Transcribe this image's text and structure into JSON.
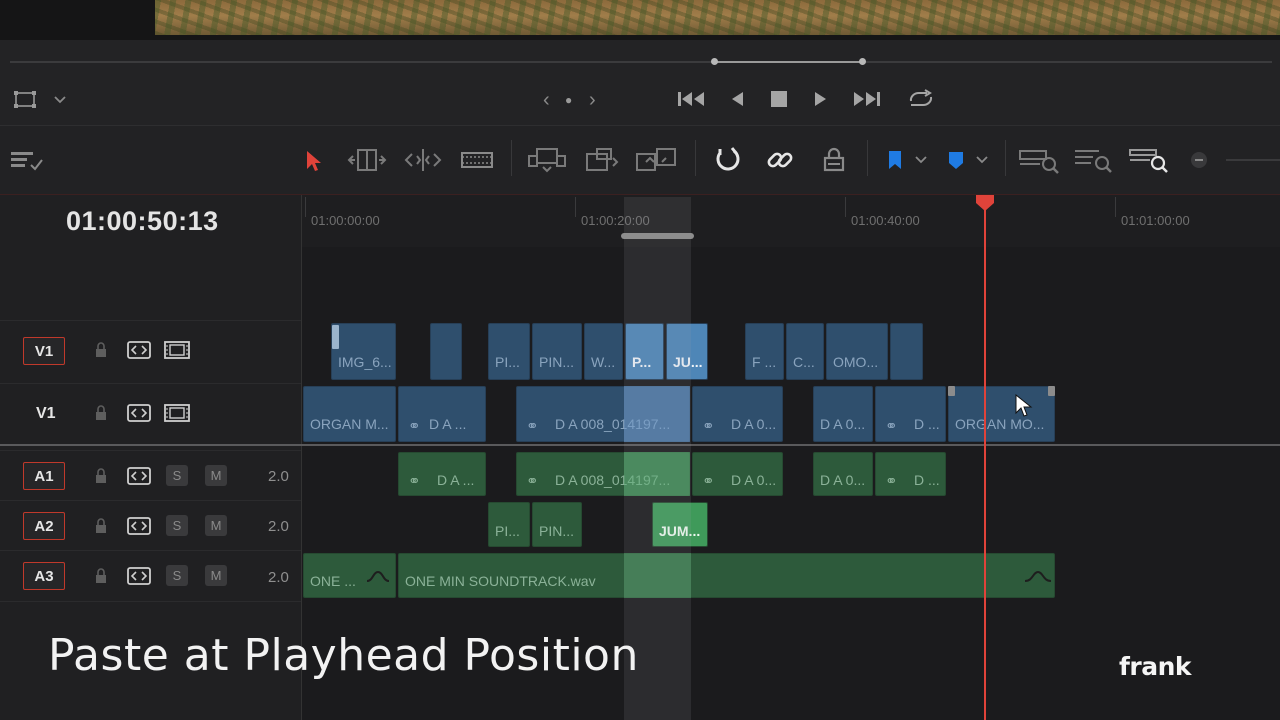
{
  "viewer": {
    "transport": {
      "nav_prev": "‹",
      "nav_dot": "●",
      "nav_next": "›"
    }
  },
  "toolbar": {
    "select_tool_icon": "arrow-pointer-icon",
    "colors": {
      "accent_red": "#e0433a",
      "flag_blue": "#1f7be3"
    }
  },
  "timeline": {
    "timecode": "01:00:50:13",
    "ruler_labels": [
      "01:00:00:00",
      "01:00:20:00",
      "01:00:40:00",
      "01:01:00:00"
    ],
    "tracks": [
      {
        "badge": "V1",
        "outlined": true
      },
      {
        "badge": "V1",
        "outlined": false
      },
      {
        "badge": "A1",
        "outlined": true,
        "solo": "S",
        "mute": "M",
        "level": "2.0"
      },
      {
        "badge": "A2",
        "outlined": true,
        "solo": "S",
        "mute": "M",
        "level": "2.0"
      },
      {
        "badge": "A3",
        "outlined": true,
        "solo": "S",
        "mute": "M",
        "level": "2.0"
      }
    ],
    "v1_top_clips": [
      "IMG_6...",
      "",
      "PI...",
      "PIN...",
      "W...",
      "P...",
      "JU...",
      "F ...",
      "C...",
      "OMO...",
      ""
    ],
    "v1_bottom_clips": [
      "ORGAN M...",
      "D A ...",
      "D A 008_014197...",
      "D A 0...",
      "D A 0...",
      "D ...",
      "ORGAN MO..."
    ],
    "a1_clips": [
      "D A ...",
      "D A 008_014197...",
      "D A 0...",
      "D A 0...",
      "D ..."
    ],
    "a2_clips": [
      "PI...",
      "PIN...",
      "JUM..."
    ],
    "a3_clips": [
      "ONE ...",
      "ONE MIN SOUNDTRACK.wav"
    ]
  },
  "caption": "Paste at Playhead Position",
  "watermark": "frank"
}
